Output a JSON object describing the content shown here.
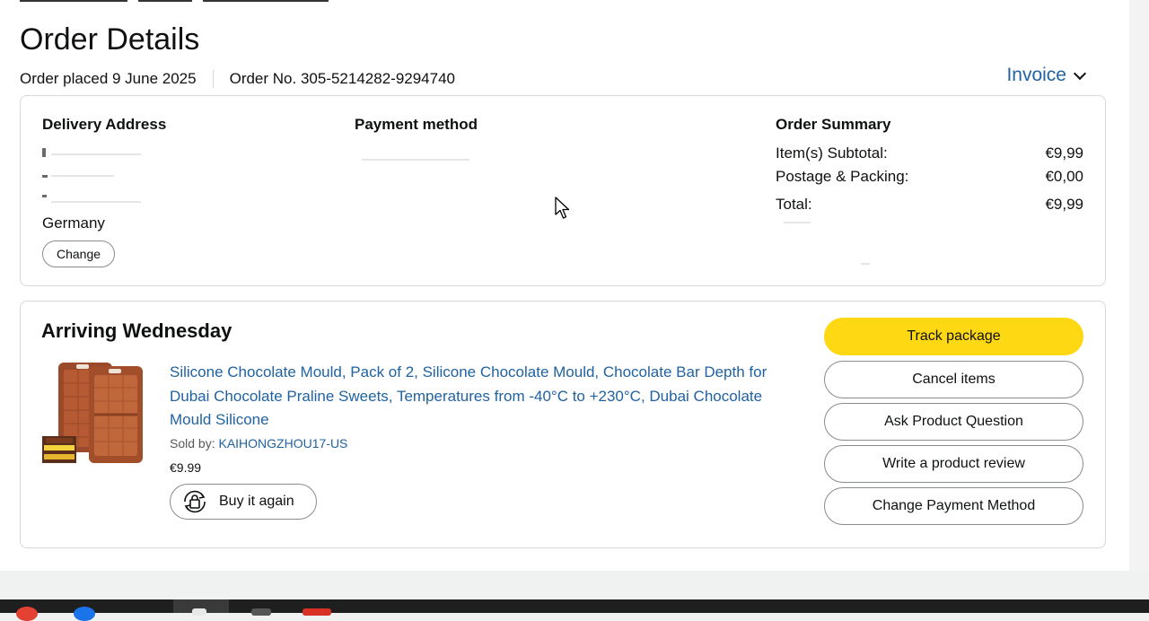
{
  "page": {
    "title": "Order Details",
    "order_placed": "Order placed 9 June 2025",
    "order_number": "Order No. 305-5214282-9294740",
    "invoice_label": "Invoice"
  },
  "delivery": {
    "heading": "Delivery Address",
    "country": "Germany",
    "change_label": "Change"
  },
  "payment": {
    "heading": "Payment method"
  },
  "summary": {
    "heading": "Order Summary",
    "rows": [
      {
        "label": "Item(s) Subtotal:",
        "value": "€9,99"
      },
      {
        "label": "Postage & Packing:",
        "value": "€0,00"
      },
      {
        "label": "Total:",
        "value": "€9,99"
      }
    ]
  },
  "shipment": {
    "heading": "Arriving Wednesday",
    "product_title": "Silicone Chocolate Mould, Pack of 2, Silicone Chocolate Mould, Chocolate Bar Depth for Dubai Chocolate Praline Sweets, Temperatures from -40°C to +230°C, Dubai Chocolate Mould Silicone",
    "sold_by_label": "Sold by:",
    "seller": "KAIHONGZHOU17-US",
    "price": "€9.99",
    "buy_again_label": "Buy it again"
  },
  "actions": {
    "track": "Track package",
    "cancel": "Cancel items",
    "ask": "Ask Product Question",
    "review": "Write a product review",
    "change_payment": "Change Payment Method"
  },
  "colors": {
    "link": "#2162a1",
    "primary_button": "#ffd814",
    "border": "#d5d9d9"
  }
}
